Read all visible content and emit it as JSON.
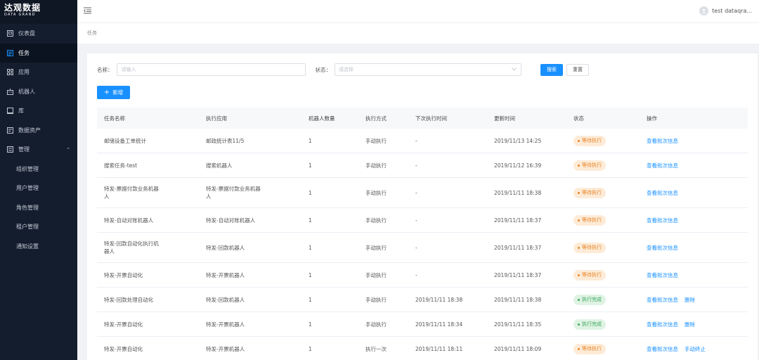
{
  "brand": {
    "name_cn": "达观数据",
    "name_en": "DATA GRAND"
  },
  "sidebar": {
    "items": [
      {
        "label": "仪表盘",
        "icon": "dashboard-icon"
      },
      {
        "label": "任务",
        "icon": "task-list-icon",
        "active": true
      },
      {
        "label": "应用",
        "icon": "apps-grid-icon"
      },
      {
        "label": "机器人",
        "icon": "robot-icon"
      },
      {
        "label": "库",
        "icon": "library-icon"
      },
      {
        "label": "数据资产",
        "icon": "data-asset-icon"
      },
      {
        "label": "管理",
        "icon": "manage-icon",
        "expanded": true
      }
    ],
    "sub_items": [
      "组织管理",
      "用户管理",
      "角色管理",
      "租户管理",
      "通知设置"
    ]
  },
  "header": {
    "user": "test dataqra..."
  },
  "breadcrumb": "任务",
  "filter": {
    "name_label": "名称：",
    "name_placeholder": "请输入",
    "status_label": "状态：",
    "status_placeholder": "请选择",
    "search": "搜索",
    "reset": "重置"
  },
  "add_button": "新增",
  "table": {
    "headers": [
      "任务名称",
      "执行应用",
      "机器人数量",
      "执行方式",
      "下次执行时间",
      "更新时间",
      "状态",
      "操作"
    ],
    "rows": [
      {
        "name": "邮储设备工单统计",
        "app": "邮政统计表11/5",
        "count": "1",
        "mode": "手动执行",
        "next": "-",
        "updated": "2019/11/13 14:25",
        "status": "等待执行",
        "status_type": "wait",
        "actions": [
          "查看批次信息"
        ]
      },
      {
        "name": "搜索任务-test",
        "app": "搜索机器人",
        "count": "1",
        "mode": "手动执行",
        "next": "-",
        "updated": "2019/11/12 16:39",
        "status": "等待执行",
        "status_type": "wait",
        "actions": [
          "查看批次信息"
        ]
      },
      {
        "name": "特发-票据付款业务机器人",
        "app": "特发-票据付款业务机器人",
        "count": "1",
        "mode": "手动执行",
        "next": "-",
        "updated": "2019/11/11 18:38",
        "status": "等待执行",
        "status_type": "wait",
        "actions": [
          "查看批次信息"
        ]
      },
      {
        "name": "特发-自动对账机器人",
        "app": "特发-自动对账机器人",
        "count": "1",
        "mode": "手动执行",
        "next": "-",
        "updated": "2019/11/11 18:37",
        "status": "等待执行",
        "status_type": "wait",
        "actions": [
          "查看批次信息"
        ]
      },
      {
        "name": "特发-回款自动化执行机器人",
        "app": "特发-回款机器人",
        "count": "1",
        "mode": "手动执行",
        "next": "-",
        "updated": "2019/11/11 18:37",
        "status": "等待执行",
        "status_type": "wait",
        "actions": [
          "查看批次信息"
        ]
      },
      {
        "name": "特发-开票自动化",
        "app": "特发-开票机器人",
        "count": "1",
        "mode": "手动执行",
        "next": "-",
        "updated": "2019/11/11 18:37",
        "status": "等待执行",
        "status_type": "wait",
        "actions": [
          "查看批次信息"
        ]
      },
      {
        "name": "特发-回款处理自动化",
        "app": "特发-回款机器人",
        "count": "1",
        "mode": "手动执行",
        "next": "2019/11/11 18:38",
        "updated": "2019/11/11 18:38",
        "status": "执行完成",
        "status_type": "done",
        "actions": [
          "查看批次信息",
          "删除"
        ]
      },
      {
        "name": "特发-开票自动化",
        "app": "特发-开票机器人",
        "count": "1",
        "mode": "手动执行",
        "next": "2019/11/11 18:34",
        "updated": "2019/11/11 18:35",
        "status": "执行完成",
        "status_type": "done",
        "actions": [
          "查看批次信息",
          "删除"
        ]
      },
      {
        "name": "特发-开票自动化",
        "app": "特发-开票机器人",
        "count": "1",
        "mode": "执行一次",
        "next": "2019/11/11 18:11",
        "updated": "2019/11/11 18:09",
        "status": "等待执行",
        "status_type": "wait",
        "actions": [
          "查看批次信息",
          "手动终止"
        ]
      }
    ]
  },
  "colors": {
    "sidebar_bg": "#141d2e",
    "primary": "#1890ff",
    "wait": "#e8862a",
    "done": "#3aa55b"
  }
}
